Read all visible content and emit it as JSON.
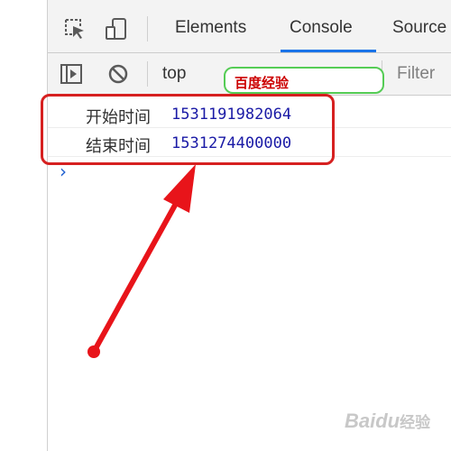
{
  "devtools": {
    "tabs": [
      {
        "label": "Elements"
      },
      {
        "label": "Console"
      },
      {
        "label": "Source"
      }
    ],
    "active_tab": "Console",
    "toolbar": {
      "context": "top",
      "filter_placeholder": "Filter"
    },
    "console": {
      "lines": [
        {
          "label": "开始时间",
          "value": "1531191982064"
        },
        {
          "label": "结束时间",
          "value": "1531274400000"
        }
      ],
      "prompt": "›"
    }
  },
  "watermarks": {
    "top": "百度经验",
    "bottom_brand": "Baidu",
    "bottom_sub": "经验"
  },
  "colors": {
    "accent": "#1a73e8",
    "highlight": "#d62020",
    "log_value": "#1a1aa6",
    "watermark_border": "#55cc55",
    "watermark_text": "#cc0000"
  },
  "icons": [
    "inspect-element-icon",
    "device-toolbar-icon",
    "sidebar-toggle-icon",
    "clear-console-icon"
  ]
}
